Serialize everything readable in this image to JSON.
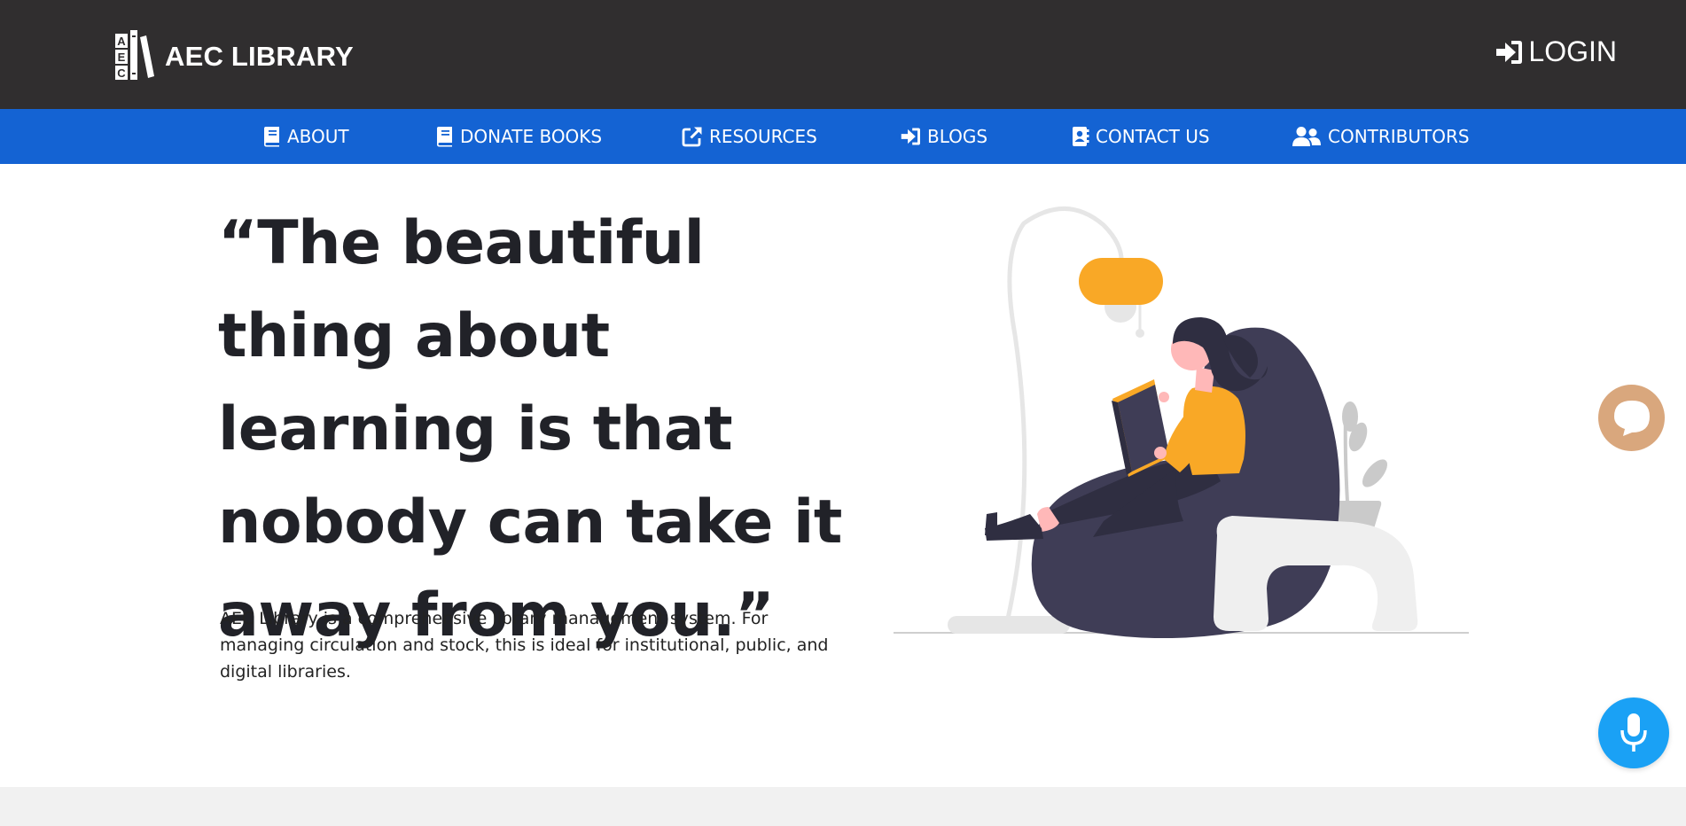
{
  "header": {
    "brand_name": "AEC LIBRARY",
    "brand_logo_letters": [
      "A",
      "E",
      "C"
    ],
    "login_label": "LOGIN"
  },
  "nav": {
    "items": [
      {
        "label": "ABOUT",
        "icon": "book-icon"
      },
      {
        "label": "DONATE BOOKS",
        "icon": "book-icon"
      },
      {
        "label": "RESOURCES",
        "icon": "external-link-icon"
      },
      {
        "label": "BLOGS",
        "icon": "sign-in-icon"
      },
      {
        "label": "CONTACT US",
        "icon": "address-book-icon"
      },
      {
        "label": "CONTRIBUTORS",
        "icon": "users-icon"
      }
    ]
  },
  "hero": {
    "quote": "“The beautiful thing about learning is that nobody can take it away from you.”",
    "description": "AEC Library is a comprehensive library management system. For managing circulation and stock, this is ideal for institutional, public, and digital libraries."
  },
  "widgets": {
    "chat_icon": "chat-bubble-icon",
    "mic_icon": "microphone-icon"
  },
  "colors": {
    "topbar": "#302e2f",
    "navbar": "#1463d3",
    "accent_yellow": "#f9a826",
    "chair": "#3f3d56",
    "chat_button": "#d9a77d",
    "mic_button": "#1aa1f5"
  }
}
